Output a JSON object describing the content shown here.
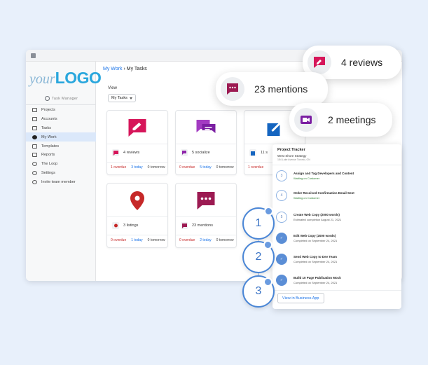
{
  "logo": {
    "your": "your",
    "brand": "LOGO",
    "tagline": "Task Manager"
  },
  "sidebar": {
    "items": [
      {
        "label": "Projects",
        "icon": "list-icon"
      },
      {
        "label": "Accounts",
        "icon": "accounts-icon"
      },
      {
        "label": "Tasks",
        "icon": "tasks-icon"
      },
      {
        "label": "My Work",
        "icon": "check-circle-icon",
        "active": true
      },
      {
        "label": "Templates",
        "icon": "templates-icon"
      },
      {
        "label": "Reports",
        "icon": "reports-icon"
      },
      {
        "label": "The Loop",
        "icon": "loop-icon"
      },
      {
        "label": "Settings",
        "icon": "gear-icon"
      },
      {
        "label": "Invite team member",
        "icon": "add-user-icon"
      }
    ]
  },
  "breadcrumb": {
    "first": "My Work",
    "separator": "›",
    "current": "My Tasks"
  },
  "view": {
    "label": "View",
    "selected": "My Tasks"
  },
  "cards": [
    {
      "label": "4 reviews",
      "overdue": "1 overdue",
      "today": "3 today",
      "tomorrow": "0 tomorrow",
      "icon": "review-icon",
      "color": "#d6165a"
    },
    {
      "label": "5 socialize",
      "overdue": "0 overdue",
      "today": "5 today",
      "tomorrow": "0 tomorrow",
      "icon": "chat-bubbles-icon",
      "color": "#8e24aa"
    },
    {
      "label": "11 s",
      "overdue": "1 overdue",
      "today": "",
      "tomorrow": "",
      "icon": "share-icon",
      "color": "#1565c0"
    },
    {
      "label": "3 listings",
      "overdue": "0 overdue",
      "today": "1 today",
      "tomorrow": "0 tomorrow",
      "icon": "location-pin-icon",
      "color": "#c62828"
    },
    {
      "label": "23 mentions",
      "overdue": "0 overdue",
      "today": "2 today",
      "tomorrow": "0 tomorrow",
      "icon": "mention-bubble-icon",
      "color": "#9c1a52"
    }
  ],
  "pills": {
    "reviews": "4 reviews",
    "mentions": "23 mentions",
    "meetings": "2 meetings"
  },
  "tracker": {
    "title": "Project Tracker",
    "subtitle": "West Shore Strategy",
    "address": "154 Lake Avenue Toronto, ON",
    "steps": [
      {
        "num": "3",
        "title": "Assign and Tag Developers and Content",
        "sub": "Waiting on Customer",
        "done": false
      },
      {
        "num": "4",
        "title": "Order Received Confirmation Email Sent",
        "sub": "Waiting on Customer",
        "done": false
      },
      {
        "num": "5",
        "title": "Create Web Copy (2000 words)",
        "sub": "Estimated completion August 21, 2021",
        "done": false
      },
      {
        "num": "",
        "title": "Edit Web Copy (2000 words)",
        "sub": "Completed on September 24, 2021",
        "done": true
      },
      {
        "num": "",
        "title": "Send Web Copy to Dev Team",
        "sub": "Completed on September 24, 2021",
        "done": true
      },
      {
        "num": "",
        "title": "Build 10 Page Publication Mock",
        "sub": "Completed on September 24, 2021",
        "done": true
      }
    ],
    "button": "View in Business App"
  },
  "big_steps": [
    "1",
    "2",
    "3"
  ]
}
